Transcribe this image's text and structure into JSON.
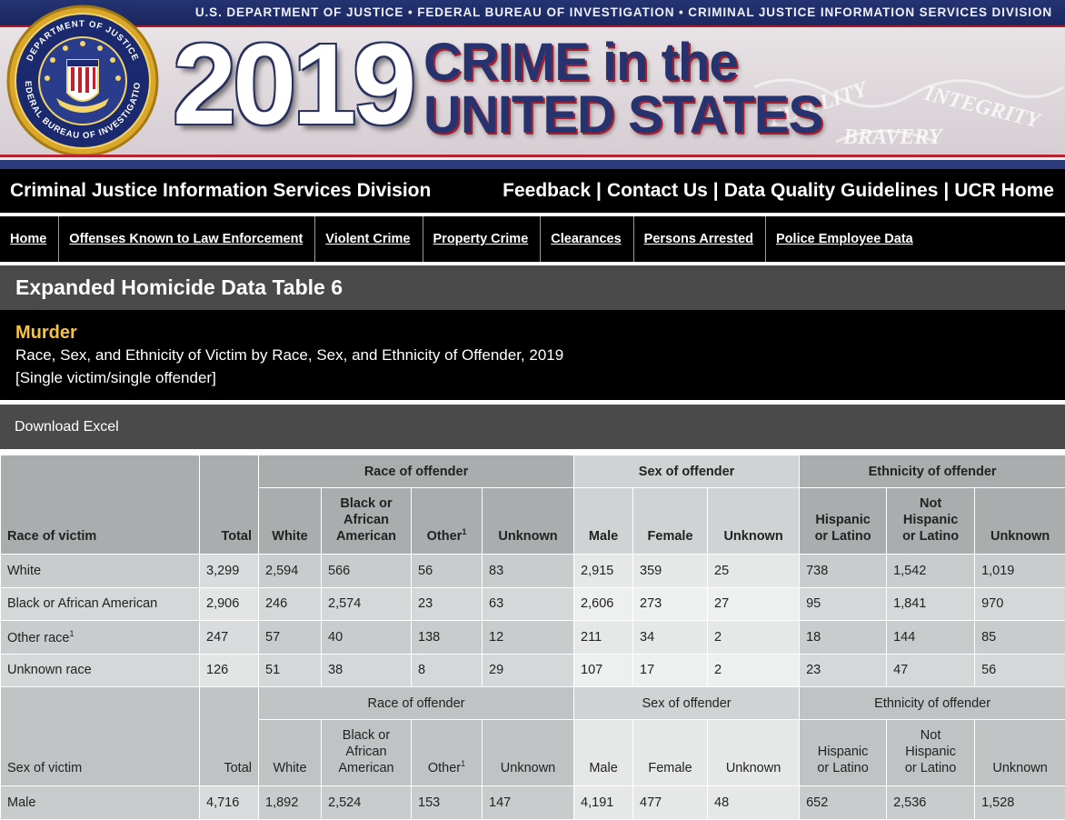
{
  "banner": {
    "agency_line": "U.S. DEPARTMENT OF JUSTICE • FEDERAL BUREAU OF INVESTIGATION • CRIMINAL JUSTICE INFORMATION SERVICES DIVISION",
    "year": "2019",
    "title_line1": "CRIME in the",
    "title_line2": "UNITED STATES",
    "seal_text_top": "DEPARTMENT OF JUSTICE",
    "seal_text_bottom": "FEDERAL BUREAU OF INVESTIGATION",
    "motto": [
      "FIDELITY",
      "BRAVERY",
      "INTEGRITY"
    ]
  },
  "division": {
    "name": "Criminal Justice Information Services Division",
    "links": [
      "Feedback",
      "Contact Us",
      "Data Quality Guidelines",
      "UCR Home"
    ]
  },
  "nav": [
    "Home",
    "Offenses Known to Law Enforcement",
    "Violent Crime",
    "Property Crime",
    "Clearances",
    "Persons Arrested",
    "Police Employee Data"
  ],
  "table_heading": "Expanded Homicide Data Table 6",
  "title": {
    "label": "Murder",
    "line1": "Race, Sex, and Ethnicity of Victim by Race, Sex, and Ethnicity of Offender, 2019",
    "line2": "[Single victim/single offender]"
  },
  "download_label": "Download Excel",
  "table": {
    "groups": [
      "Race of offender",
      "Sex of offender",
      "Ethnicity of offender"
    ],
    "columns": {
      "total": "Total",
      "white": "White",
      "black_1": "Black or",
      "black_2": "African",
      "black_3": "American",
      "other": "Other",
      "other_sup": "1",
      "unknown": "Unknown",
      "male": "Male",
      "female": "Female",
      "hisp_1": "Hispanic",
      "hisp_2": "or Latino",
      "nothisp_1": "Not",
      "nothisp_2": "Hispanic",
      "nothisp_3": "or Latino"
    },
    "section1_label": "Race of victim",
    "section1_rows": [
      {
        "label": "White",
        "sup": "",
        "values": [
          "3,299",
          "2,594",
          "566",
          "56",
          "83",
          "2,915",
          "359",
          "25",
          "738",
          "1,542",
          "1,019"
        ]
      },
      {
        "label": "Black or African American",
        "sup": "",
        "values": [
          "2,906",
          "246",
          "2,574",
          "23",
          "63",
          "2,606",
          "273",
          "27",
          "95",
          "1,841",
          "970"
        ]
      },
      {
        "label": "Other race",
        "sup": "1",
        "values": [
          "247",
          "57",
          "40",
          "138",
          "12",
          "211",
          "34",
          "2",
          "18",
          "144",
          "85"
        ]
      },
      {
        "label": "Unknown race",
        "sup": "",
        "values": [
          "126",
          "51",
          "38",
          "8",
          "29",
          "107",
          "17",
          "2",
          "23",
          "47",
          "56"
        ]
      }
    ],
    "section2_label": "Sex of victim",
    "section2_rows": [
      {
        "label": "Male",
        "sup": "",
        "values": [
          "4,716",
          "1,892",
          "2,524",
          "153",
          "147",
          "4,191",
          "477",
          "48",
          "652",
          "2,536",
          "1,528"
        ]
      }
    ]
  }
}
